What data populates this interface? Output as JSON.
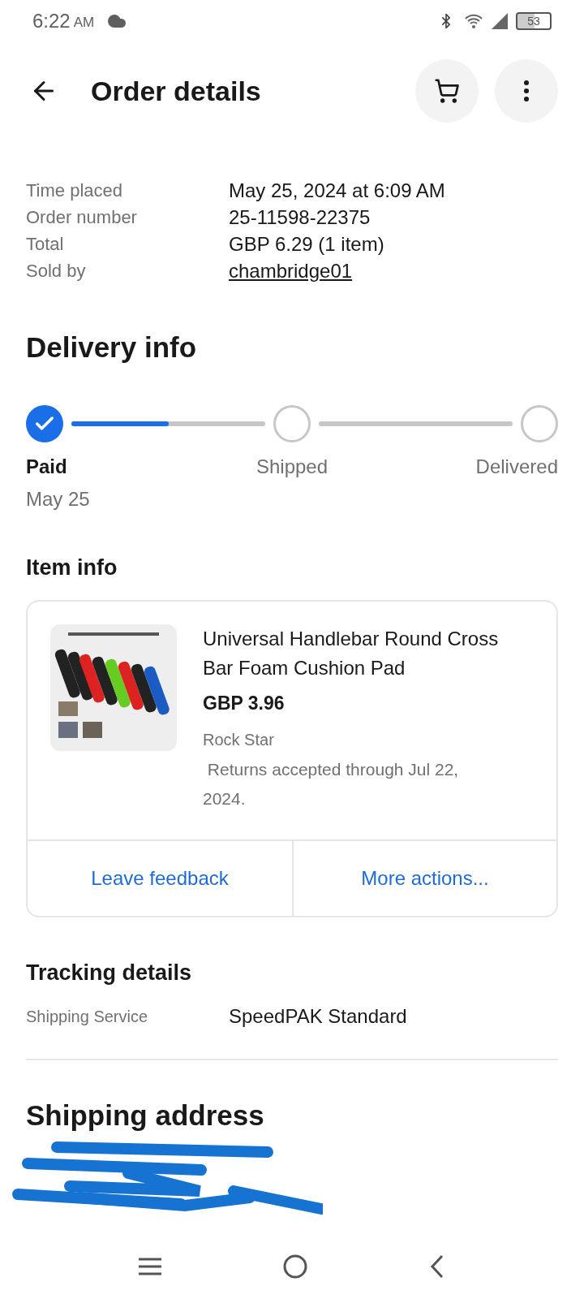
{
  "status_bar": {
    "time": "6:22",
    "ampm": "AM",
    "battery": "53"
  },
  "header": {
    "title": "Order details"
  },
  "summary": [
    {
      "label": "Time placed",
      "value": "May 25, 2024 at 6:09 AM",
      "link": false
    },
    {
      "label": "Order number",
      "value": "25-11598-22375",
      "link": false
    },
    {
      "label": "Total",
      "value": "GBP 6.29 (1 item)",
      "link": false
    },
    {
      "label": "Sold by",
      "value": "chambridge01",
      "link": true
    }
  ],
  "delivery": {
    "title": "Delivery info",
    "steps": [
      {
        "label": "Paid",
        "date": "May 25",
        "done": true
      },
      {
        "label": "Shipped",
        "done": false
      },
      {
        "label": "Delivered",
        "done": false
      }
    ],
    "connectors": [
      {
        "level": 0.5
      }
    ]
  },
  "item_info": {
    "title": "Item info",
    "image": {
      "kind": "picture"
    },
    "name": "Universal Handlebar Round Cross Bar Foam Cushion Pad",
    "price": "GBP 3.96",
    "variant": "Rock Star",
    "returns": " Returns accepted through Jul 22, 2024.",
    "actions": [
      "Leave feedback",
      "More actions..."
    ]
  },
  "tracking": {
    "title": "Tracking details",
    "label": "Shipping Service",
    "value": "SpeedPAK Standard"
  },
  "shipping_address": {
    "title": "Shipping address"
  }
}
